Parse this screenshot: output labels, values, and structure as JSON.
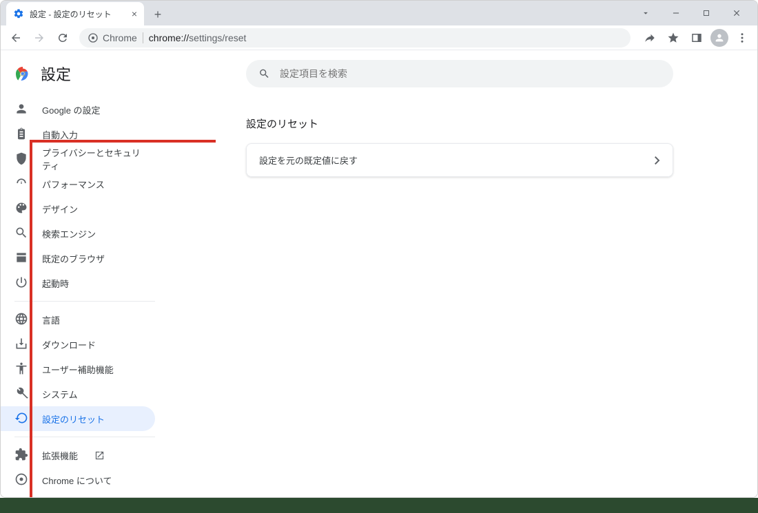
{
  "window": {
    "tab_title": "設定 - 設定のリセット",
    "address_chip": "Chrome",
    "address_host": "chrome://",
    "address_path": "settings/reset"
  },
  "sidebar": {
    "title": "設定",
    "items": [
      {
        "label": "Google の設定",
        "icon": "person"
      },
      {
        "label": "自動入力",
        "icon": "clipboard"
      },
      {
        "label": "プライバシーとセキュリティ",
        "icon": "shield"
      },
      {
        "label": "パフォーマンス",
        "icon": "speed"
      },
      {
        "label": "デザイン",
        "icon": "palette"
      },
      {
        "label": "検索エンジン",
        "icon": "search"
      },
      {
        "label": "既定のブラウザ",
        "icon": "browser"
      },
      {
        "label": "起動時",
        "icon": "power"
      }
    ],
    "items2": [
      {
        "label": "言語",
        "icon": "globe"
      },
      {
        "label": "ダウンロード",
        "icon": "download"
      },
      {
        "label": "ユーザー補助機能",
        "icon": "accessibility"
      },
      {
        "label": "システム",
        "icon": "wrench"
      },
      {
        "label": "設定のリセット",
        "icon": "restore",
        "active": true
      }
    ],
    "items3": [
      {
        "label": "拡張機能",
        "icon": "extension",
        "launch": true
      },
      {
        "label": "Chrome について",
        "icon": "chrome"
      }
    ]
  },
  "main": {
    "search_placeholder": "設定項目を検索",
    "section_title": "設定のリセット",
    "reset_row_label": "設定を元の既定値に戻す"
  }
}
